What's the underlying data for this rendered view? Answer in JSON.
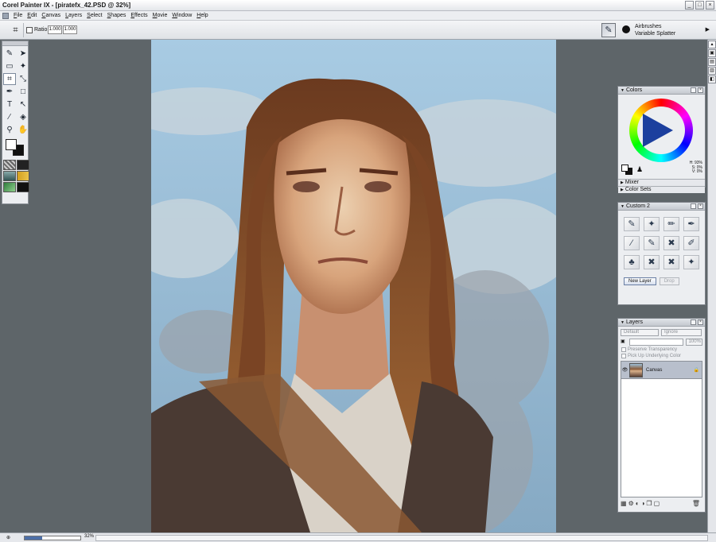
{
  "window": {
    "title": "Corel Painter IX - [piratefx_42.PSD @ 32%]",
    "buttons": [
      "_",
      "□",
      "×"
    ]
  },
  "menu": {
    "items": [
      "File",
      "Edit",
      "Canvas",
      "Layers",
      "Select",
      "Shapes",
      "Effects",
      "Movie",
      "Window",
      "Help"
    ]
  },
  "property_bar": {
    "ratio_label": "Ratio:",
    "ratio_width": "1.000",
    "ratio_height": "1.000"
  },
  "brush_selector": {
    "category": "Airbrushes",
    "variant": "Variable Splatter"
  },
  "colors_palette": {
    "title": "Colors",
    "values_line1": "H: 93%",
    "values_line2": "S: 0%",
    "values_line3": "V: 0%",
    "mixer_label": "Mixer",
    "color_sets_label": "Color Sets",
    "hue_color": "#1c3f9e"
  },
  "custom_palette": {
    "title": "Custom 2",
    "new_layer_label": "New Layer",
    "drop_label": "Drop"
  },
  "layers_palette": {
    "title": "Layers",
    "composite_method": "Default",
    "composite_depth": "Ignore",
    "opacity": "100%",
    "preserve_transparency": "Preserve Transparency",
    "pick_up_underlying": "Pick Up Underlying Color",
    "layer_name": "Canvas"
  },
  "status": {
    "zoom": "32%",
    "zoom_fraction": 0.32
  }
}
